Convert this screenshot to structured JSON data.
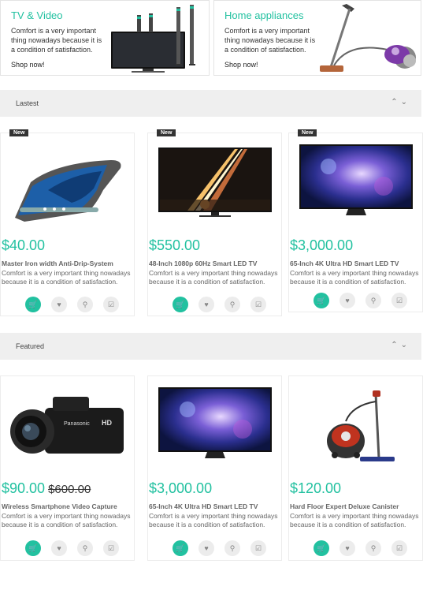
{
  "banners": [
    {
      "title": "TV & Video",
      "desc": "Comfort is a very important thing nowadays because it is a condition of satisfaction.",
      "shop": "Shop now!"
    },
    {
      "title": "Home appliances",
      "desc": "Comfort is a very important thing nowadays because it is a condition of satisfaction.",
      "shop": "Shop now!"
    }
  ],
  "sections": [
    {
      "title": "Lastest"
    },
    {
      "title": "Featured"
    }
  ],
  "latest": [
    {
      "badge": "New",
      "price": "$40.00",
      "name": "Master Iron width Anti-Drip-System",
      "desc": "Comfort is a very important thing nowadays because it is a condition of satisfaction."
    },
    {
      "badge": "New",
      "price": "$550.00",
      "name": "48-Inch 1080p 60Hz Smart LED TV",
      "desc": "Comfort is a very important thing nowadays because it is a condition of satisfaction."
    },
    {
      "badge": "New",
      "price": "$3,000.00",
      "name": "65-Inch 4K Ultra HD Smart LED TV",
      "desc": "Comfort is a very important thing nowadays because it is a condition of satisfaction."
    }
  ],
  "featured": [
    {
      "price": "$90.00",
      "old_price": "$600.00",
      "name": "Wireless Smartphone Video Capture",
      "desc": "Comfort is a very important thing nowadays because it is a condition of satisfaction."
    },
    {
      "price": "$3,000.00",
      "name": "65-Inch 4K Ultra HD Smart LED TV",
      "desc": "Comfort is a very important thing nowadays because it is a condition of satisfaction."
    },
    {
      "price": "$120.00",
      "name": "Hard Floor Expert Deluxe Canister",
      "desc": "Comfort is a very important thing nowadays because it is a condition of satisfaction."
    }
  ],
  "camera_brand": "Panasonic",
  "camera_hd": "HD",
  "colors": {
    "accent": "#22c1a0",
    "badge": "#333333"
  }
}
